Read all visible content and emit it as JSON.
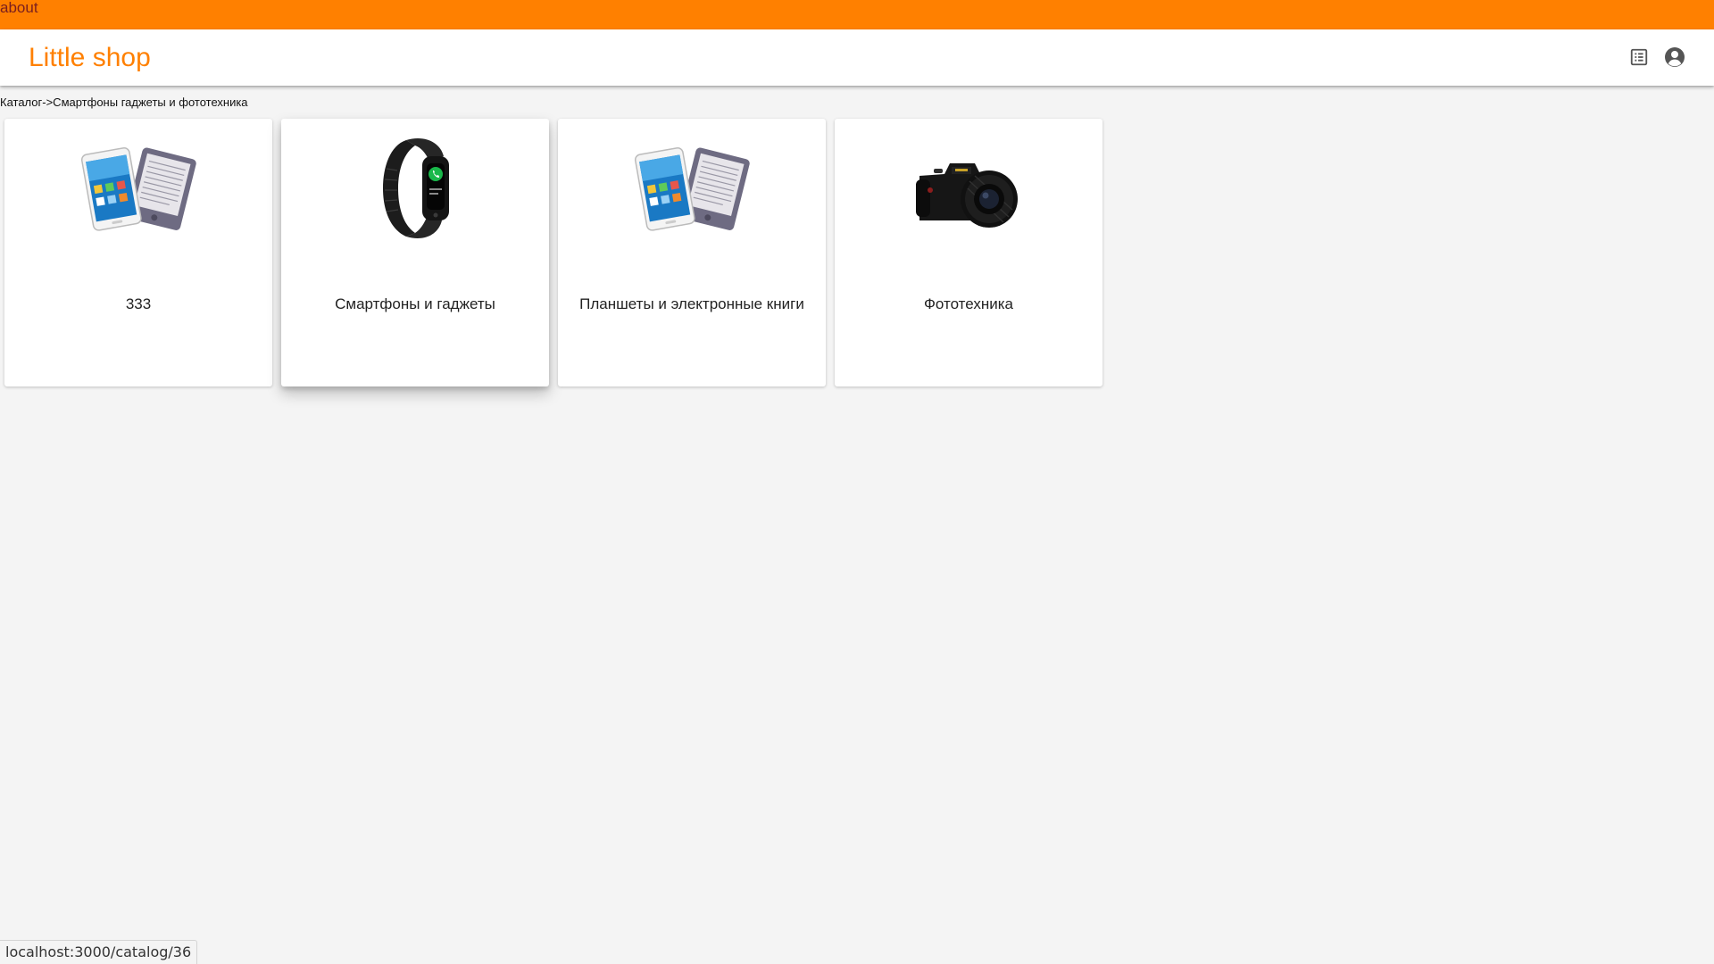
{
  "topbar": {
    "about_link": "about"
  },
  "appbar": {
    "brand": "Little shop",
    "icons": [
      "list-alt-icon",
      "account-circle-icon"
    ]
  },
  "breadcrumb": "Каталог->Смартфоны гаджеты и фототехника",
  "categories": [
    {
      "title": "333",
      "image": "tablet-ebook-image"
    },
    {
      "title": "Смартфоны и гаджеты",
      "image": "fitness-band-image"
    },
    {
      "title": "Планшеты и электронные книги",
      "image": "tablet-ebook-image"
    },
    {
      "title": "Фототехника",
      "image": "dslr-camera-image"
    }
  ],
  "status_url": "localhost:3000/catalog/36",
  "colors": {
    "accent": "#ff8000",
    "about_link": "#7a1f1f",
    "page_background": "#f4f4f4",
    "card_background": "#ffffff"
  }
}
